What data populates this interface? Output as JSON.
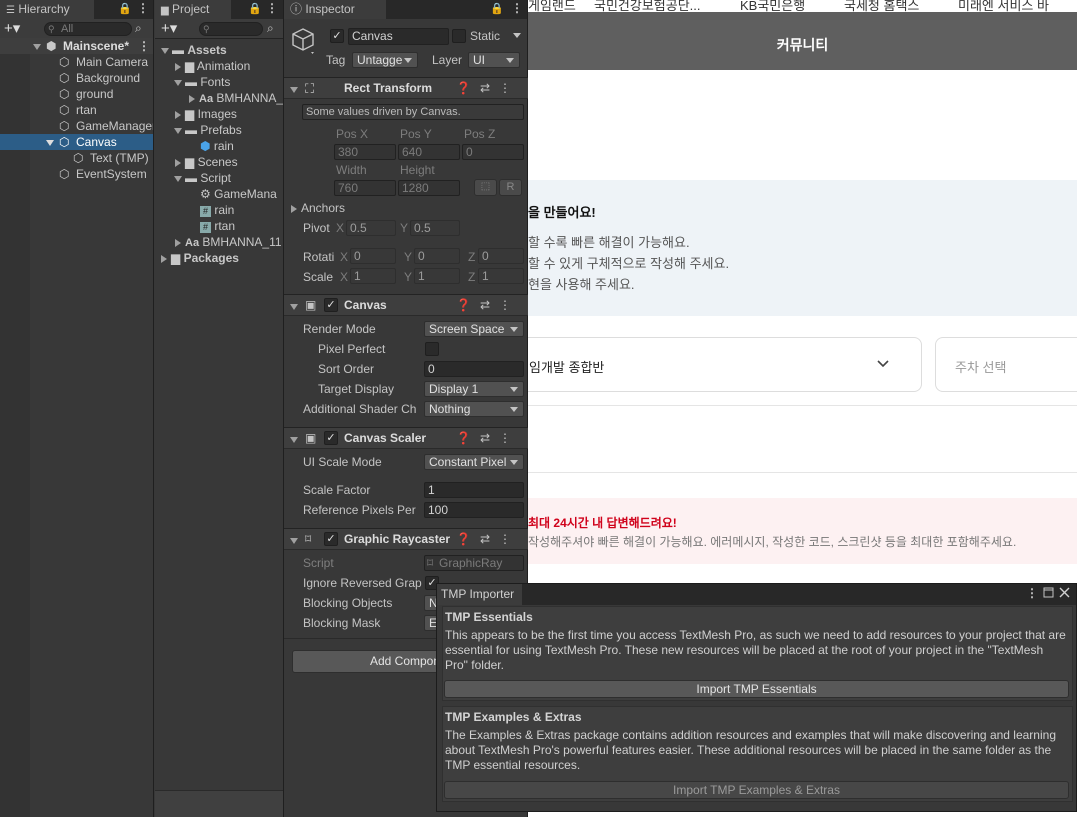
{
  "web": {
    "bookmarks": [
      "게임랜드",
      "국민건강보험공단...",
      "KB국민은행",
      "국세청 홈택스",
      "미래엔 서비스 바"
    ],
    "header_title": "커뮤니티",
    "notice_title": "을 만들어요!",
    "notice_lines": [
      "할 수록 빠른 해결이 가능해요.",
      "할 수 있게 구체적으로 작성해 주세요.",
      "현을 사용해 주세요."
    ],
    "course_select": "임개발 종합반",
    "week_select_placeholder": "주차 선택",
    "warning_title": "최대 24시간 내 답변해드려요!",
    "warning_text": "작성해주셔야 빠른 해결이 가능해요. 에러메시지, 작성한 코드, 스크린샷 등을 최대한 포함해주세요."
  },
  "hierarchy": {
    "tab": "Hierarchy",
    "search_placeholder": "All",
    "scene": "Mainscene*",
    "items": [
      "Main Camera",
      "Background",
      "ground",
      "rtan",
      "GameManager",
      "Canvas",
      "Text (TMP)",
      "EventSystem"
    ],
    "selected": "Canvas"
  },
  "project": {
    "tab": "Project",
    "items": {
      "assets": "Assets",
      "animation": "Animation",
      "fonts": "Fonts",
      "font_asset": "BMHANNA_",
      "images": "Images",
      "prefabs": "Prefabs",
      "rain_prefab": "rain",
      "scenes": "Scenes",
      "script": "Script",
      "game_manager": "GameMana",
      "rain_script": "rain",
      "rtan_script": "rtan",
      "font_asset2": "BMHANNA_11",
      "packages": "Packages"
    }
  },
  "inspector": {
    "tab": "Inspector",
    "object_name": "Canvas",
    "static_label": "Static",
    "tag_label": "Tag",
    "tag_value": "Untagge",
    "layer_label": "Layer",
    "layer_value": "UI",
    "rect": {
      "title": "Rect Transform",
      "note": "Some values driven by Canvas.",
      "posx_label": "Pos X",
      "posy_label": "Pos Y",
      "posz_label": "Pos Z",
      "posx": "380",
      "posy": "640",
      "posz": "0",
      "width_label": "Width",
      "height_label": "Height",
      "width": "760",
      "height": "1280",
      "r_btn": "R",
      "anchors": "Anchors",
      "pivot": "Pivot",
      "pivot_x": "0.5",
      "pivot_y": "0.5",
      "rotation": "Rotati",
      "rot_x": "0",
      "rot_y": "0",
      "rot_z": "0",
      "scale": "Scale",
      "scale_x": "1",
      "scale_y": "1",
      "scale_z": "1",
      "x": "X",
      "y": "Y",
      "z": "Z"
    },
    "canvas": {
      "title": "Canvas",
      "render_mode_label": "Render Mode",
      "render_mode": "Screen Space",
      "pixel_perfect_label": "Pixel Perfect",
      "sort_order_label": "Sort Order",
      "sort_order": "0",
      "target_display_label": "Target Display",
      "target_display": "Display 1",
      "shader_label": "Additional Shader Ch",
      "shader_value": "Nothing"
    },
    "scaler": {
      "title": "Canvas Scaler",
      "ui_scale_label": "UI Scale Mode",
      "ui_scale": "Constant Pixel",
      "scale_factor_label": "Scale Factor",
      "scale_factor": "1",
      "ref_pixels_label": "Reference Pixels Per",
      "ref_pixels": "100"
    },
    "raycaster": {
      "title": "Graphic Raycaster",
      "script_label": "Script",
      "script_value": "GraphicRay",
      "ignore_label": "Ignore Reversed Grap",
      "blocking_objects_label": "Blocking Objects",
      "blocking_objects": "N",
      "blocking_mask_label": "Blocking Mask",
      "blocking_mask": "E"
    },
    "add_component": "Add Compon"
  },
  "tmp_importer": {
    "tab": "TMP Importer",
    "essentials_title": "TMP Essentials",
    "essentials_text": "This appears to be the first time you access TextMesh Pro, as such we need to add resources to your project that are essential for using TextMesh Pro. These new resources will be placed at the root of your project in the \"TextMesh Pro\" folder.",
    "essentials_button": "Import TMP Essentials",
    "extras_title": "TMP Examples & Extras",
    "extras_text": "The Examples & Extras package contains addition resources and examples that will make discovering and learning about TextMesh Pro's powerful features easier. These additional resources will be placed in the same folder as the TMP essential resources.",
    "extras_button": "Import TMP Examples & Extras"
  }
}
